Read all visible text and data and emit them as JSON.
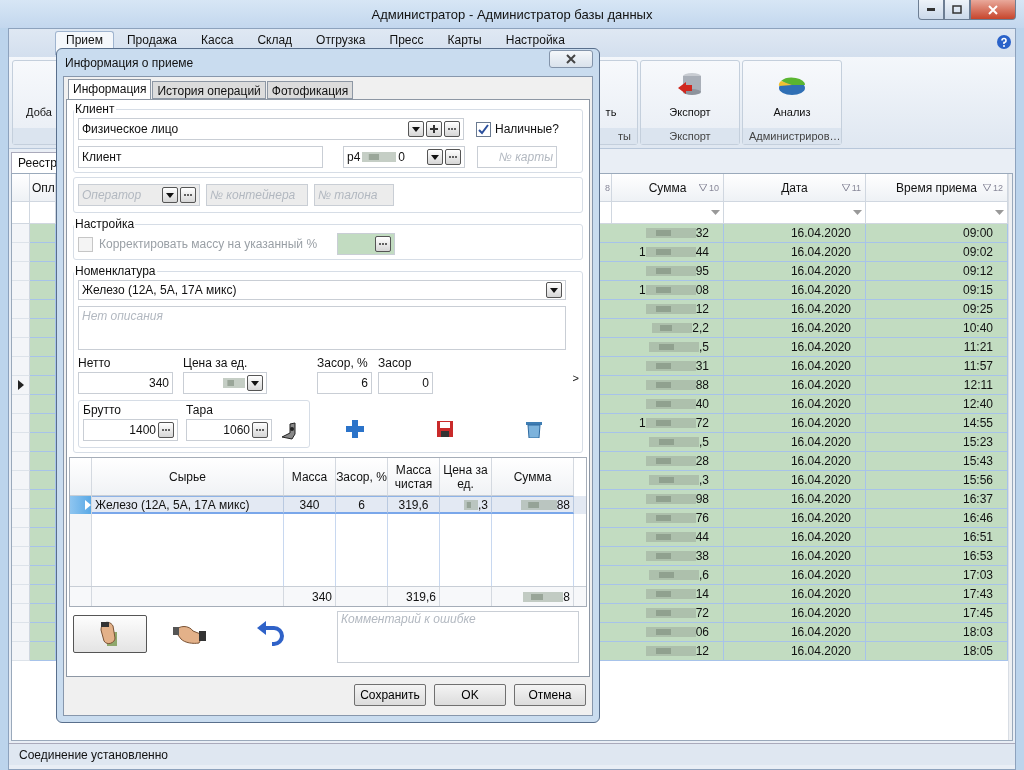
{
  "window": {
    "title": "Администратор - Администратор базы данных"
  },
  "menu_tabs": [
    {
      "label": "Прием",
      "selected": true
    },
    {
      "label": "Продажа",
      "selected": false
    },
    {
      "label": "Касса",
      "selected": false
    },
    {
      "label": "Склад",
      "selected": false
    },
    {
      "label": "Отгрузка",
      "selected": false
    },
    {
      "label": "Пресс",
      "selected": false
    },
    {
      "label": "Карты",
      "selected": false
    },
    {
      "label": "Настройка",
      "selected": false
    }
  ],
  "ribbon": {
    "groups": [
      {
        "label": "ты",
        "buttons": [
          {
            "label": "Доба",
            "kind": "plain"
          },
          {
            "label": "ть",
            "kind": "plain"
          }
        ]
      },
      {
        "label": "Экспорт",
        "buttons": [
          {
            "label": "Экспорт",
            "kind": "export"
          }
        ]
      },
      {
        "label": "Администриров…",
        "buttons": [
          {
            "label": "Анализ",
            "kind": "analysis"
          }
        ]
      }
    ]
  },
  "document_tabs": [
    {
      "label": "Реестр",
      "selected": true
    }
  ],
  "grid": {
    "columns": [
      {
        "label": "Опл"
      },
      {
        "number": "8"
      },
      {
        "label": "Сумма",
        "number": "10"
      },
      {
        "label": "Дата",
        "number": "11"
      },
      {
        "label": "Время приема",
        "number": "12"
      }
    ],
    "rows": [
      {
        "sum": "32",
        "date": "16.04.2020",
        "time": "09:00",
        "selected": false
      },
      {
        "sum_lead": "1",
        "sum": "44",
        "date": "16.04.2020",
        "time": "09:02",
        "selected": false
      },
      {
        "sum": "95",
        "date": "16.04.2020",
        "time": "09:12",
        "selected": false
      },
      {
        "sum_lead": "1",
        "sum": "08",
        "date": "16.04.2020",
        "time": "09:15",
        "selected": false
      },
      {
        "sum": "12",
        "date": "16.04.2020",
        "time": "09:25",
        "selected": false
      },
      {
        "sum": "2,2",
        "date": "16.04.2020",
        "time": "10:40",
        "selected": false
      },
      {
        "sum": ",5",
        "date": "16.04.2020",
        "time": "11:21",
        "selected": false
      },
      {
        "sum": "31",
        "date": "16.04.2020",
        "time": "11:57",
        "selected": false
      },
      {
        "sum": "88",
        "date": "16.04.2020",
        "time": "12:11",
        "selected": true
      },
      {
        "sum": "40",
        "date": "16.04.2020",
        "time": "12:40",
        "selected": false
      },
      {
        "sum_lead": "1",
        "sum": "72",
        "date": "16.04.2020",
        "time": "14:55",
        "selected": false
      },
      {
        "sum": ",5",
        "date": "16.04.2020",
        "time": "15:23",
        "selected": false
      },
      {
        "sum": "28",
        "date": "16.04.2020",
        "time": "15:43",
        "selected": false
      },
      {
        "sum": ",3",
        "date": "16.04.2020",
        "time": "15:56",
        "selected": false
      },
      {
        "sum": "98",
        "date": "16.04.2020",
        "time": "16:37",
        "selected": false
      },
      {
        "sum": "76",
        "date": "16.04.2020",
        "time": "16:46",
        "selected": false
      },
      {
        "sum": "44",
        "date": "16.04.2020",
        "time": "16:51",
        "selected": false
      },
      {
        "sum": "38",
        "date": "16.04.2020",
        "time": "16:53",
        "selected": false
      },
      {
        "sum": ",6",
        "date": "16.04.2020",
        "time": "17:03",
        "selected": false
      },
      {
        "sum": "14",
        "date": "16.04.2020",
        "time": "17:43",
        "selected": false
      },
      {
        "sum": "72",
        "date": "16.04.2020",
        "time": "17:45",
        "selected": false
      },
      {
        "sum": "06",
        "date": "16.04.2020",
        "time": "18:03",
        "selected": false
      },
      {
        "sum": "12",
        "date": "16.04.2020",
        "time": "18:05",
        "selected": false
      }
    ]
  },
  "status_bar": "Соединение установленно",
  "dialog": {
    "title": "Информация о приеме",
    "tabs": [
      {
        "label": "Информация",
        "selected": true
      },
      {
        "label": "История операций",
        "selected": false
      },
      {
        "label": "Фотофикация",
        "selected": false
      }
    ],
    "client": {
      "legend": "Клиент",
      "type": "Физическое лицо",
      "cash": {
        "label": "Наличные?",
        "checked": true
      },
      "name": "Клиент",
      "account_prefix": "р4",
      "account_suffix": "0",
      "card_placeholder": "№ карты"
    },
    "operator": {
      "disabled": true,
      "operator_placeholder": "Оператор",
      "container_placeholder": "№ контейнера",
      "ticket_placeholder": "№ талона"
    },
    "settings": {
      "legend": "Настройка",
      "correct": {
        "label": "Корректировать массу на указанный %",
        "checked": false,
        "disabled": true
      }
    },
    "nomenclature": {
      "legend": "Номенклатура",
      "material": "Железо (12А, 5А, 17А микс)",
      "description_placeholder": "Нет описания",
      "netto": {
        "label": "Нетто",
        "value": "340"
      },
      "price": {
        "label": "Цена за ед."
      },
      "debris_percent": {
        "label": "Засор, %",
        "value": "6"
      },
      "debris": {
        "label": "Засор",
        "value": "0"
      },
      "brutto": {
        "label": "Брутто",
        "value": "1400"
      },
      "tare": {
        "label": "Тара",
        "value": "1060"
      },
      "expand": ">"
    },
    "items": {
      "columns": [
        "Сырье",
        "Масса",
        "Засор, %",
        "Масса чистая",
        "Цена за ед.",
        "Сумма"
      ],
      "rows": [
        {
          "cells": [
            "Железо (12А, 5А, 17А микс)",
            "340",
            "6",
            "319,6",
            ",3",
            "88"
          ],
          "selected": true
        }
      ],
      "totals": {
        "mass": "340",
        "net_mass": "319,6",
        "sum": "8"
      }
    },
    "tools": [
      {
        "kind": "pay",
        "selected": true
      },
      {
        "kind": "deal",
        "selected": false
      },
      {
        "kind": "undo",
        "selected": false
      }
    ],
    "comment_placeholder": "Комментарий к ошибке",
    "buttons": [
      "Сохранить",
      "OK",
      "Отмена"
    ]
  }
}
